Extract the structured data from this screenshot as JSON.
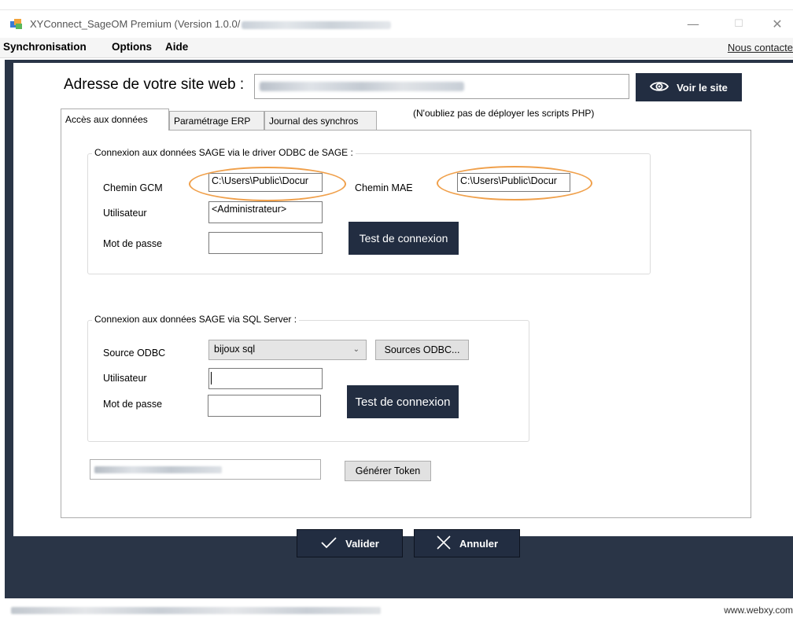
{
  "window": {
    "title": "XYConnect_SageOM Premium (Version 1.0.0/",
    "title_suffix_redacted": "",
    "icon": "app-icon",
    "controls": {
      "minimize": "—",
      "maximize": "☐",
      "close": "✕"
    }
  },
  "menu": {
    "items": [
      "Synchronisation",
      "Options",
      "Aide"
    ],
    "contact": "Nous contacte"
  },
  "site": {
    "label": "Adresse de votre site web :",
    "value_redacted": "",
    "view_button": "Voir le site",
    "view_icon": "eye-icon",
    "hint": "(N'oubliez pas de déployer les scripts PHP)"
  },
  "tabs": [
    "Accès aux données",
    "Paramétrage ERP",
    "Journal des synchros"
  ],
  "odbc_driver": {
    "title": "Connexion aux données SAGE via le driver ODBC de SAGE :",
    "gcm_label": "Chemin GCM",
    "gcm_value": "C:\\Users\\Public\\Docur",
    "mae_label": "Chemin MAE",
    "mae_value": "C:\\Users\\Public\\Docur",
    "user_label": "Utilisateur",
    "user_value": "<Administrateur>",
    "password_label": "Mot de passe",
    "password_value": "",
    "test_button": "Test de connexion"
  },
  "sql_server": {
    "title": "Connexion aux données SAGE via SQL Server :",
    "source_label": "Source ODBC",
    "source_value": "bijoux sql",
    "sources_button": "Sources ODBC...",
    "user_label": "Utilisateur",
    "user_value": "",
    "password_label": "Mot de passe",
    "password_value": "",
    "test_button": "Test de connexion"
  },
  "token": {
    "value_redacted": "",
    "generate_button": "Générer Token"
  },
  "actions": {
    "validate": "Valider",
    "validate_icon": "check-icon",
    "cancel": "Annuler",
    "cancel_icon": "close-icon"
  },
  "status": {
    "right_text": "www.webxy.com"
  },
  "colors": {
    "dark_navy": "#222d41",
    "frame": "#2a3547",
    "highlight_orange": "#f0a04b"
  }
}
